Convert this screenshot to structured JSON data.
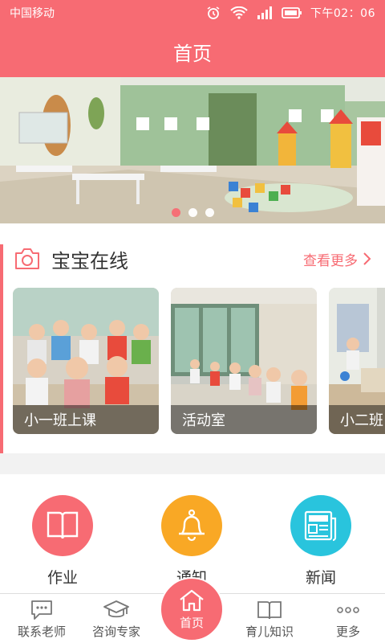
{
  "status_bar": {
    "carrier": "中国移动",
    "time": "下午02：06"
  },
  "header": {
    "title": "首页"
  },
  "banner": {
    "dots": 3,
    "active_index": 0
  },
  "online": {
    "title": "宝宝在线",
    "more_label": "查看更多",
    "cards": [
      {
        "label": "小一班上课"
      },
      {
        "label": "活动室"
      },
      {
        "label": "小二班"
      }
    ]
  },
  "features": [
    {
      "label": "作业",
      "color": "#f76b73",
      "icon": "book-icon"
    },
    {
      "label": "通知",
      "color": "#f9a825",
      "icon": "bell-icon"
    },
    {
      "label": "新闻",
      "color": "#29c4dd",
      "icon": "news-icon"
    }
  ],
  "tabbar": {
    "items": [
      {
        "label": "联系老师",
        "icon": "chat-icon"
      },
      {
        "label": "咨询专家",
        "icon": "graduation-cap-icon"
      },
      {
        "label": "首页",
        "icon": "home-icon"
      },
      {
        "label": "育儿知识",
        "icon": "open-book-icon"
      },
      {
        "label": "更多",
        "icon": "more-dots-icon"
      }
    ]
  },
  "colors": {
    "primary": "#f76b73",
    "notice": "#f9a825",
    "news": "#29c4dd"
  }
}
